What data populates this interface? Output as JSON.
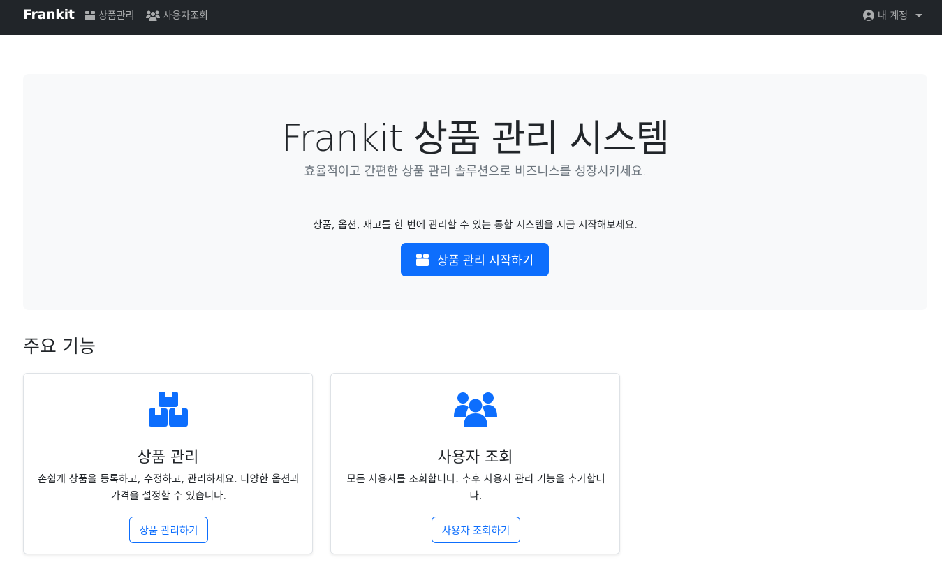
{
  "navbar": {
    "brand": "Frankit",
    "links": [
      {
        "label": "상품관리",
        "icon": "box-icon"
      },
      {
        "label": "사용자조회",
        "icon": "users-icon"
      }
    ],
    "account": {
      "label": "내 계정",
      "icon": "user-circle-icon"
    }
  },
  "hero": {
    "title": "Frankit 상품 관리 시스템",
    "lead": "효율적이고 간편한 상품 관리 솔루션으로 비즈니스를 성장시키세요.",
    "text": "상품, 옵션, 재고를 한 번에 관리할 수 있는 통합 시스템을 지금 시작해보세요.",
    "button": "상품 관리 시작하기"
  },
  "features": {
    "title": "주요 기능",
    "cards": [
      {
        "icon": "boxes-icon",
        "title": "상품 관리",
        "text": "손쉽게 상품을 등록하고, 수정하고, 관리하세요. 다양한 옵션과 가격을 설정할 수 있습니다.",
        "button": "상품 관리하기"
      },
      {
        "icon": "users-icon",
        "title": "사용자 조회",
        "text": "모든 사용자를 조회합니다. 추후 사용자 관리 기능을 추가합니다.",
        "button": "사용자 조회하기"
      }
    ]
  },
  "colors": {
    "navbar_bg": "#212529",
    "primary": "#0d6efd",
    "hero_bg": "#f8f9fa"
  }
}
